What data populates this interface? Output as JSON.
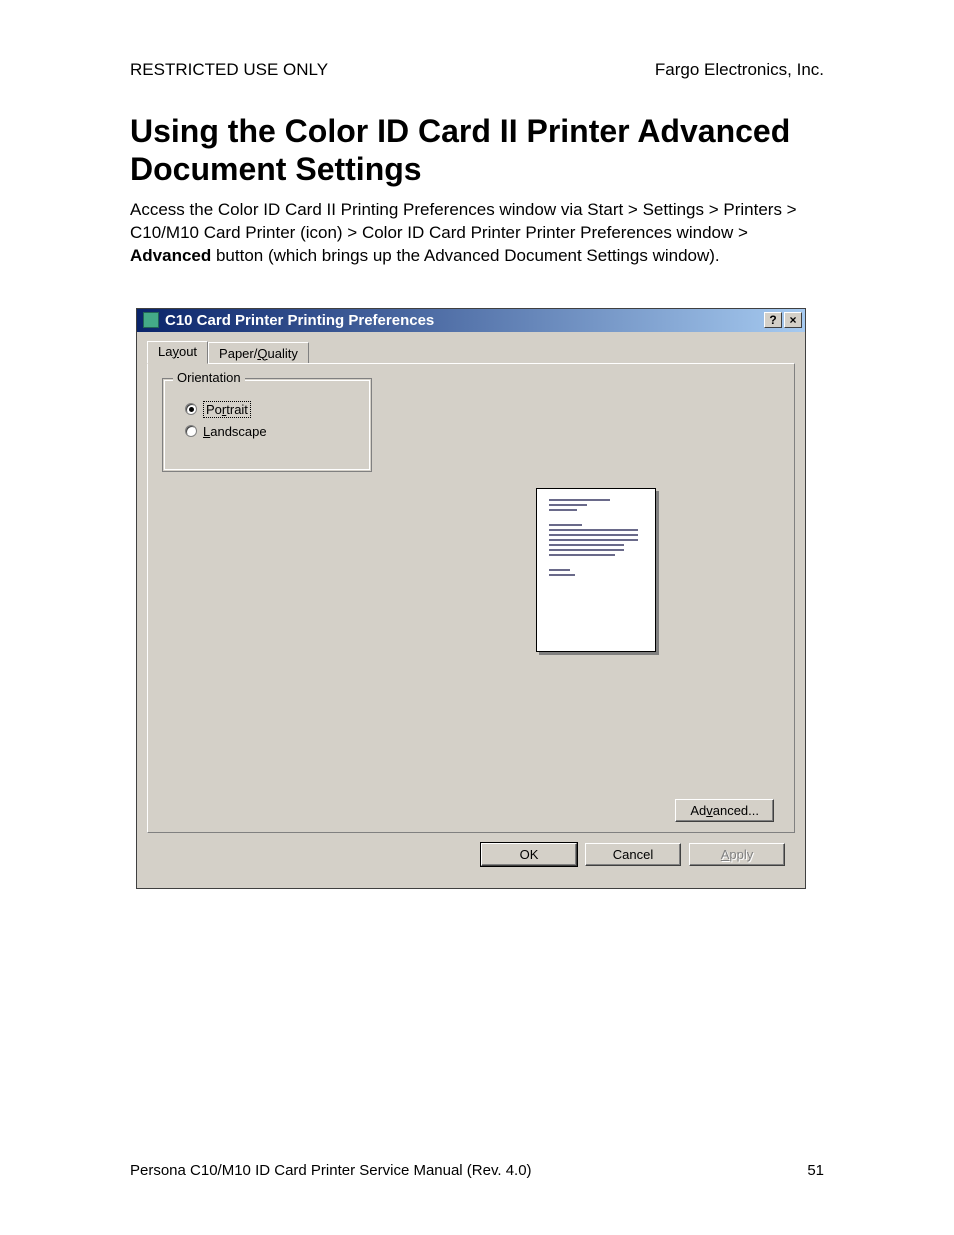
{
  "header": {
    "left": "RESTRICTED USE ONLY",
    "right": "Fargo Electronics, Inc."
  },
  "heading": "Using the Color ID Card II Printer Advanced Document Settings",
  "intro": {
    "line1": "Access the Color ID Card II Printing Preferences window via Start > Settings > Printers > C10/M10 Card Printer (icon) > Color ID Card Printer Printer Preferences window > ",
    "bold": "Advanced",
    "line2": " button (which brings up the Advanced Document Settings window)."
  },
  "dialog": {
    "title": "C10 Card Printer Printing Preferences",
    "help_glyph": "?",
    "close_glyph": "×",
    "tabs": {
      "layout_prefix": "La",
      "layout_mn": "y",
      "layout_suffix": "out",
      "paper_prefix": "Paper/",
      "paper_mn": "Q",
      "paper_suffix": "uality"
    },
    "orientation": {
      "legend": "Orientation",
      "portrait_prefix": "Po",
      "portrait_mn": "r",
      "portrait_suffix": "trait",
      "landscape_mn": "L",
      "landscape_suffix": "andscape",
      "selected": "portrait"
    },
    "advanced_btn_prefix": "Ad",
    "advanced_btn_mn": "v",
    "advanced_btn_suffix": "anced...",
    "ok": "OK",
    "cancel": "Cancel",
    "apply_mn": "A",
    "apply_suffix": "pply"
  },
  "footer": {
    "left": "Persona C10/M10 ID Card Printer Service Manual (Rev. 4.0)",
    "page": "51"
  }
}
